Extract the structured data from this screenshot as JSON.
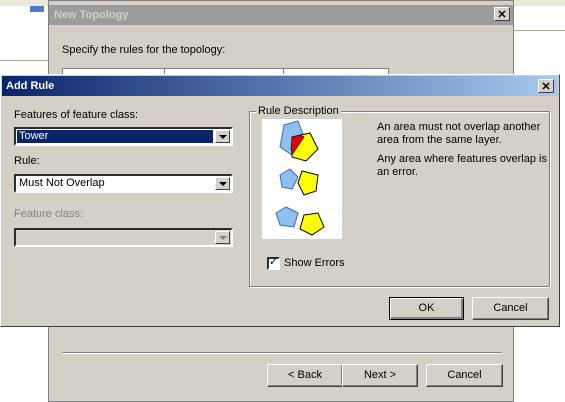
{
  "new_topology": {
    "title": "New Topology",
    "instruction": "Specify the rules for the topology:",
    "back_label": "< Back",
    "next_label": "Next >",
    "cancel_label": "Cancel"
  },
  "add_rule": {
    "title": "Add Rule",
    "close_glyph": "×",
    "features_label": "Features of feature class:",
    "features_value": "Tower",
    "rule_label": "Rule:",
    "rule_value": "Must Not Overlap",
    "feature_class_label": "Feature class:",
    "feature_class_value": "",
    "rule_description_title": "Rule Description",
    "description_line1": "An area must not overlap another area from the same layer.",
    "description_line2": "Any area where features overlap is an error.",
    "show_errors_label": "Show Errors",
    "show_errors_checked": true,
    "ok_label": "OK",
    "cancel_label": "Cancel"
  },
  "colors": {
    "blue_shape": "#8fbff0",
    "yellow_shape": "#ffff00",
    "error_red": "#e00000",
    "title_active": "#0a246a"
  }
}
